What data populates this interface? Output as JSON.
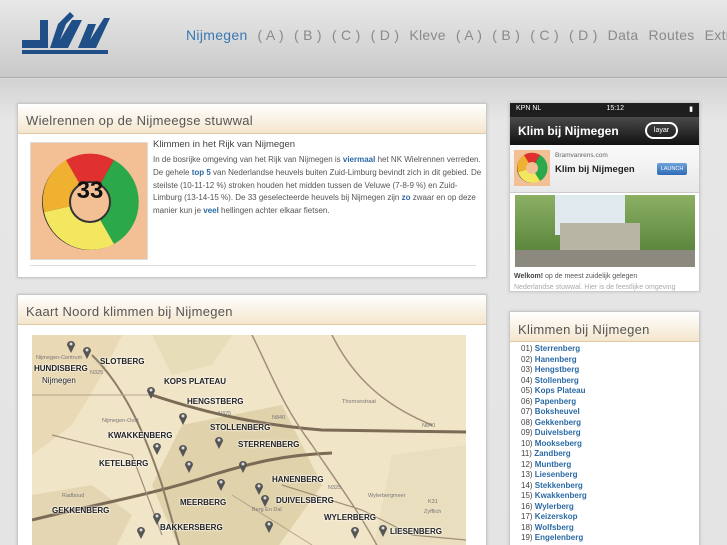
{
  "header": {
    "nav": [
      "Nijmegen",
      "( A )",
      "( B )",
      "( C )",
      "( D )",
      "Kleve",
      "( A )",
      "( B )",
      "( C )",
      "( D )",
      "Data",
      "Routes",
      "Extra"
    ]
  },
  "intro": {
    "title": "Wielrennen op de Nijmeegse stuwwal",
    "gauge_value": "33",
    "subtitle": "Klimmen in het Rijk van Nijmegen",
    "text_1": "In de bosrijke omgeving van het Rijk van Nijmegen is ",
    "text_2": "viermaal",
    "text_3": " het NK Wielrennen verreden. De gehele ",
    "text_4": "top 5",
    "text_5": " van Nederlandse heuvels buiten Zuid-Limburg bevindt zich in dit gebied. De steilste (10-11-12 %) stroken houden het midden tussen de Veluwe (7-8-9 %) en Zuid-Limburg (13-14-15 %). De 33 geselecteerde heuvels bij Nijmegen zijn ",
    "text_6": "zo",
    "text_7": " zwaar en op deze manier kun je ",
    "text_8": "veel",
    "text_9": " hellingen achter elkaar fietsen.",
    "gauge_colors": [
      "#e03030",
      "#2aa84a",
      "#f4e760",
      "#f0b030"
    ]
  },
  "map": {
    "title": "Kaart Noord klimmen bij Nijmegen",
    "labels": {
      "nijmegen_centrum": "Nijmegen-Centrum",
      "hundisberg": "HUNDISBERG",
      "nijmegen": "Nijmegen",
      "slotberg": "SLOTBERG",
      "kops_plateau": "KOPS PLATEAU",
      "hengstberg": "HENGSTBERG",
      "stollenberg": "STOLLENBERG",
      "kwakkenberg": "KWAKKENBERG",
      "sterrenberg": "STERRENBERG",
      "ketelberg": "KETELBERG",
      "hanenberg": "HANENBERG",
      "duivelsberg": "DUIVELSBERG",
      "meerberg": "MEERBERG",
      "wylerberg": "WYLERBERG",
      "gekkenberg": "GEKKENBERG",
      "bakkersberg": "BAKKERSBERG",
      "liesenberg": "LIESENBERG",
      "n325": "N325",
      "n840": "N840",
      "k31": "K31",
      "nijmegen_oost": "Nijmegen-Oost",
      "berg_en_dal": "Berg En Dal",
      "zyfflich": "Zyfflich",
      "wylerbergmeer": "Wylerbergmeer",
      "thornsestraat": "Thornsestraat",
      "radboud": "Radboud"
    }
  },
  "ad": {
    "carrier": "KPN NL",
    "time": "15:12",
    "banner": "Klim bij Nijmegen",
    "layar": "layar",
    "site": "Bramvanrens.com",
    "app_name": "Klim bij Nijmegen",
    "launch": "LAUNCH",
    "caption_bold": "Welkom!",
    "caption": " op de meest zuidelijk gelegen",
    "caption2": "Nederlandse stuwwal. Hier is de feestlijke omgeving"
  },
  "list": {
    "title": "Klimmen bij Nijmegen",
    "items": [
      {
        "n": "01)",
        "name": "Sterrenberg"
      },
      {
        "n": "02)",
        "name": "Hanenberg"
      },
      {
        "n": "03)",
        "name": "Hengstberg"
      },
      {
        "n": "04)",
        "name": "Stollenberg"
      },
      {
        "n": "05)",
        "name": "Kops Plateau"
      },
      {
        "n": "06)",
        "name": "Papenberg"
      },
      {
        "n": "07)",
        "name": "Boksheuvel"
      },
      {
        "n": "08)",
        "name": "Gekkenberg"
      },
      {
        "n": "09)",
        "name": "Duivelsberg"
      },
      {
        "n": "10)",
        "name": "Mookseberg"
      },
      {
        "n": "11)",
        "name": "Zandberg"
      },
      {
        "n": "12)",
        "name": "Muntberg"
      },
      {
        "n": "13)",
        "name": "Liesenberg"
      },
      {
        "n": "14)",
        "name": "Stekkenberg"
      },
      {
        "n": "15)",
        "name": "Kwakkenberg"
      },
      {
        "n": "16)",
        "name": "Wylerberg"
      },
      {
        "n": "17)",
        "name": "Keizerskop"
      },
      {
        "n": "18)",
        "name": "Wolfsberg"
      },
      {
        "n": "19)",
        "name": "Engelenberg"
      }
    ]
  }
}
